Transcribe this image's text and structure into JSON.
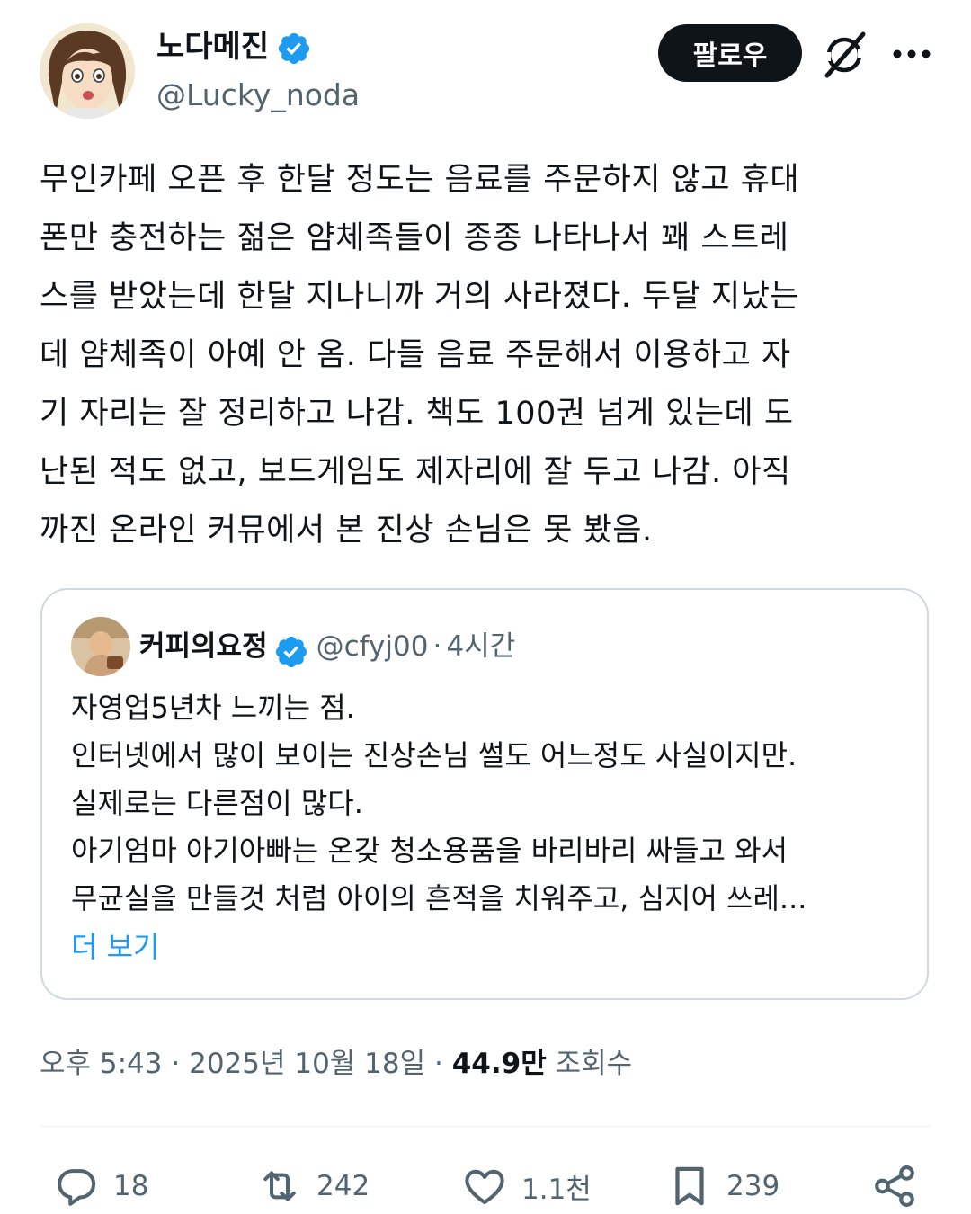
{
  "author": {
    "display_name": "노다메진",
    "handle": "@Lucky_noda",
    "verified_icon": "verified-badge-icon",
    "avatar": "anime-character-avatar"
  },
  "header": {
    "follow_label": "팔로우",
    "grok_icon": "grok-icon",
    "more_icon": "more-dots-icon"
  },
  "tweet": {
    "lines": [
      "무인카페 오픈 후 한달 정도는 음료를 주문하지 않고 휴대",
      "폰만 충전하는 젊은 얌체족들이 종종 나타나서 꽤 스트레",
      "스를 받았는데 한달 지나니까 거의 사라졌다. 두달 지났는",
      "데 얌체족이 아예 안 옴. 다들 음료 주문해서 이용하고 자",
      "기 자리는 잘 정리하고 나감. 책도 100권 넘게 있는데 도",
      "난된 적도 없고, 보드게임도 제자리에 잘 두고 나감. 아직",
      "까진 온라인 커뮤에서 본 진상 손님은 못 봤음."
    ]
  },
  "quote": {
    "display_name": "커피의요정",
    "handle": "@cfyj00",
    "separator": "·",
    "time": "4시간",
    "lines": [
      "자영업5년차 느끼는 점.",
      "인터넷에서 많이 보이는 진상손님 썰도 어느정도 사실이지만.",
      "실제로는 다른점이 많다.",
      "아기엄마 아기아빠는 온갖 청소용품을 바리바리 싸들고 와서",
      "무균실을 만들것 처럼 아이의 흔적을 치워주고, 심지어 쓰레..."
    ],
    "more_label": "더 보기"
  },
  "meta": {
    "time": "오후 5:43",
    "separator": "·",
    "date": "2025년 10월 18일",
    "views_count": "44.9만",
    "views_label": "조회수"
  },
  "actions": {
    "replies": "18",
    "retweets": "242",
    "likes": "1.1천",
    "bookmarks": "239"
  },
  "colors": {
    "accent": "#1d9bf0",
    "text": "#0f1419",
    "secondary": "#536471",
    "border": "#cfd9de"
  }
}
